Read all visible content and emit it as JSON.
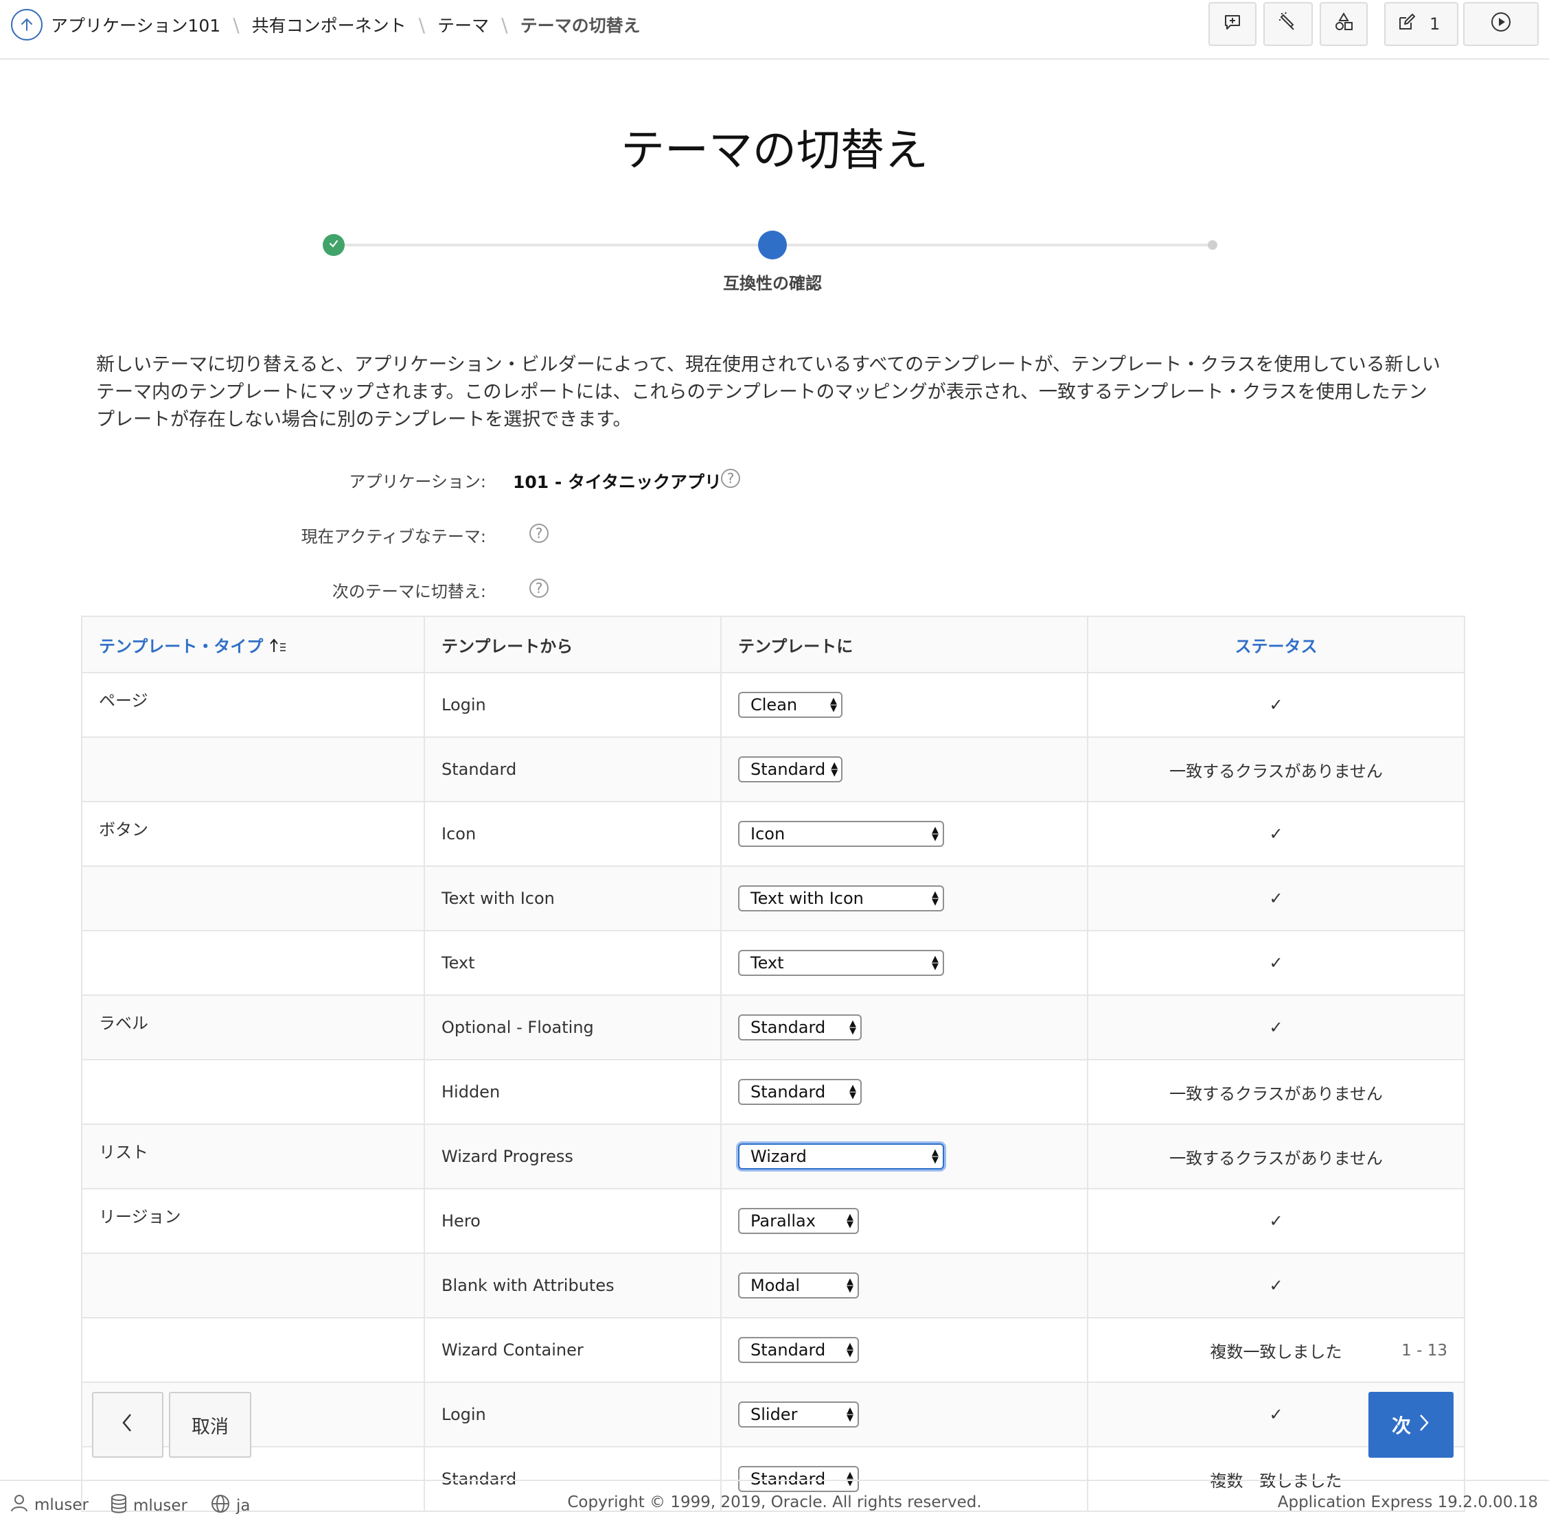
{
  "breadcrumb": {
    "items": [
      "アプリケーション101",
      "共有コンポーネント",
      "テーマ"
    ],
    "current": "テーマの切替え"
  },
  "toolbar": {
    "edit_count": "1",
    "icons": [
      "comment-add-icon",
      "highlight-icon",
      "shapes-icon",
      "edit-icon",
      "play-icon"
    ]
  },
  "page": {
    "title": "テーマの切替え",
    "wizard_step_label": "互換性の確認",
    "description": "新しいテーマに切り替えると、アプリケーション・ビルダーによって、現在使用されているすべてのテンプレートが、テンプレート・クラスを使用している新しいテーマ内のテンプレートにマップされます。このレポートには、これらのテンプレートのマッピングが表示され、一致するテンプレート・クラスを使用したテンプレートが存在しない場合に別のテンプレートを選択できます。"
  },
  "fields": {
    "application_label": "アプリケーション:",
    "application_value": "101 - タイタニックアプリ",
    "current_theme_label": "現在アクティブなテーマ:",
    "switch_to_label": "次のテーマに切替え:",
    "help_glyph": "?"
  },
  "table": {
    "headers": {
      "template_type": "テンプレート・タイプ",
      "from_template": "テンプレートから",
      "to_template": "テンプレートに",
      "status": "ステータス"
    },
    "rows": [
      {
        "type": "ページ",
        "from": "Login",
        "to": "Clean",
        "status": "✓"
      },
      {
        "type": "",
        "from": "Standard",
        "to": "Standard",
        "status": "一致するクラスがありません"
      },
      {
        "type": "ボタン",
        "from": "Icon",
        "to": "Icon",
        "status": "✓"
      },
      {
        "type": "",
        "from": "Text with Icon",
        "to": "Text with Icon",
        "status": "✓"
      },
      {
        "type": "",
        "from": "Text",
        "to": "Text",
        "status": "✓"
      },
      {
        "type": "ラベル",
        "from": "Optional - Floating",
        "to": "Standard",
        "status": "✓"
      },
      {
        "type": "",
        "from": "Hidden",
        "to": "Standard",
        "status": "一致するクラスがありません"
      },
      {
        "type": "リスト",
        "from": "Wizard Progress",
        "to": "Wizard",
        "status": "一致するクラスがありません"
      },
      {
        "type": "リージョン",
        "from": "Hero",
        "to": "Parallax",
        "status": "✓"
      },
      {
        "type": "",
        "from": "Blank with Attributes",
        "to": "Modal",
        "status": "✓"
      },
      {
        "type": "",
        "from": "Wizard Container",
        "to": "Standard",
        "status": "複数一致しました"
      },
      {
        "type": "",
        "from": "Login",
        "to": "Slider",
        "status": "✓"
      },
      {
        "type": "",
        "from": "Standard",
        "to": "Standard",
        "status": "複数一致しました"
      }
    ],
    "pagination": "1 - 13"
  },
  "buttons": {
    "cancel": "取消",
    "next": "次"
  },
  "footer": {
    "user": "mluser",
    "schema": "mluser",
    "language": "ja",
    "copyright": "Copyright © 1999, 2019, Oracle. All rights reserved.",
    "version": "Application Express 19.2.0.00.18"
  },
  "colors": {
    "accent": "#2f6fc8",
    "success": "#42a36a"
  }
}
